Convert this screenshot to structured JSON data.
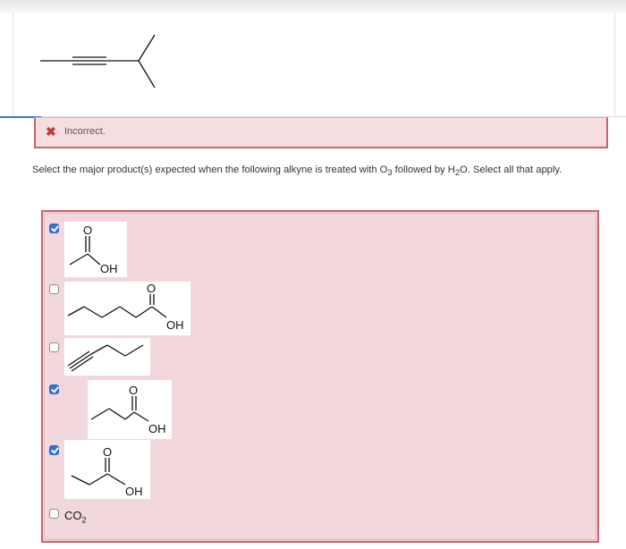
{
  "feedback": {
    "icon": "x-icon",
    "text": "Incorrect."
  },
  "question": {
    "prefix": "Select the major product(s) expected when the following alkyne is treated with O",
    "sub1": "3",
    "middle": " followed by H",
    "sub2": "2",
    "suffix": "O. Select all that apply."
  },
  "options": [
    {
      "checked": true,
      "labels": [
        "O",
        "OH"
      ]
    },
    {
      "checked": false,
      "labels": [
        "O",
        "OH"
      ]
    },
    {
      "checked": false,
      "labels": []
    },
    {
      "checked": true,
      "labels": [
        "O",
        "OH"
      ]
    },
    {
      "checked": true,
      "labels": [
        "O",
        "OH"
      ]
    },
    {
      "checked": false,
      "labels": [
        "CO",
        "2"
      ]
    }
  ],
  "colors": {
    "error_border": "#c9646d",
    "error_fill": "#f6dde0",
    "checkbox_blue": "#2f74d8"
  }
}
